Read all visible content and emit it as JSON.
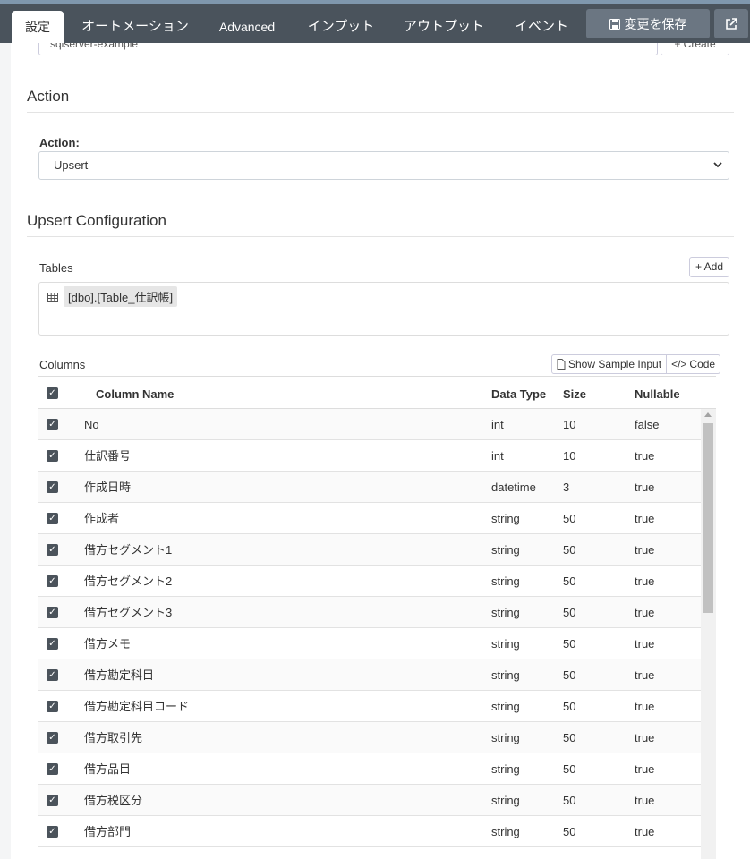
{
  "tabs": [
    {
      "label": "設定"
    },
    {
      "label": "オートメーション"
    },
    {
      "label": "Advanced"
    },
    {
      "label": "インプット"
    },
    {
      "label": "アウトプット"
    },
    {
      "label": "イベント"
    }
  ],
  "toolbar": {
    "save_label": "変更を保存"
  },
  "connection": {
    "value": "sqlserver-example",
    "create_label": "+ Create"
  },
  "action_section": {
    "title": "Action",
    "field_label": "Action:",
    "selected": "Upsert"
  },
  "upsert_section": {
    "title": "Upsert Configuration",
    "tables_label": "Tables",
    "add_label": "+ Add",
    "table_name": "[dbo].[Table_仕訳帳]",
    "columns_label": "Columns",
    "sample_input_label": "Show Sample Input",
    "code_label": "Code"
  },
  "grid": {
    "headers": {
      "name": "Column Name",
      "type": "Data Type",
      "size": "Size",
      "nullable": "Nullable"
    },
    "rows": [
      {
        "name": "No",
        "type": "int",
        "size": "10",
        "nullable": "false"
      },
      {
        "name": "仕訳番号",
        "type": "int",
        "size": "10",
        "nullable": "true"
      },
      {
        "name": "作成日時",
        "type": "datetime",
        "size": "3",
        "nullable": "true"
      },
      {
        "name": "作成者",
        "type": "string",
        "size": "50",
        "nullable": "true"
      },
      {
        "name": "借方セグメント1",
        "type": "string",
        "size": "50",
        "nullable": "true"
      },
      {
        "name": "借方セグメント2",
        "type": "string",
        "size": "50",
        "nullable": "true"
      },
      {
        "name": "借方セグメント3",
        "type": "string",
        "size": "50",
        "nullable": "true"
      },
      {
        "name": "借方メモ",
        "type": "string",
        "size": "50",
        "nullable": "true"
      },
      {
        "name": "借方勘定科目",
        "type": "string",
        "size": "50",
        "nullable": "true"
      },
      {
        "name": "借方勘定科目コード",
        "type": "string",
        "size": "50",
        "nullable": "true"
      },
      {
        "name": "借方取引先",
        "type": "string",
        "size": "50",
        "nullable": "true"
      },
      {
        "name": "借方品目",
        "type": "string",
        "size": "50",
        "nullable": "true"
      },
      {
        "name": "借方税区分",
        "type": "string",
        "size": "50",
        "nullable": "true"
      },
      {
        "name": "借方部門",
        "type": "string",
        "size": "50",
        "nullable": "true"
      }
    ]
  }
}
